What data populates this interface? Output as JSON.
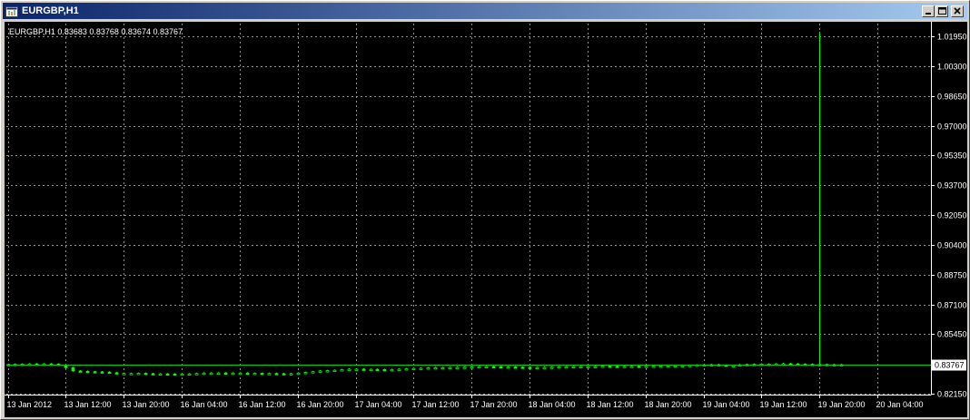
{
  "window": {
    "title": "EURGBP,H1"
  },
  "icons": {
    "app": "chart-app-icon",
    "minimize": "minimize-icon",
    "maximize": "maximize-icon",
    "close": "close-icon"
  },
  "colors": {
    "background": "#000000",
    "grid": "#c0c0c0",
    "bars": "#00ff00",
    "axis": "#ffffff",
    "text": "#ffffff",
    "price_line": "#00cc00"
  },
  "chart_data": {
    "type": "candlestick",
    "header": "EURGBP,H1  0.83683 0.83768 0.83674 0.83767",
    "current_price": 0.83767,
    "current_price_label": "0.83767",
    "ylim": [
      0.8211,
      1.0265
    ],
    "ytick_values": [
      1.0195,
      1.003,
      0.9865,
      0.97,
      0.9535,
      0.937,
      0.9205,
      0.904,
      0.8875,
      0.871,
      0.8545,
      0.8215
    ],
    "ytick_labels": [
      "1.01950",
      "1.00300",
      "0.98650",
      "0.97000",
      "0.95350",
      "0.93700",
      "0.92050",
      "0.90400",
      "0.88750",
      "0.87100",
      "0.85450",
      "0.82150"
    ],
    "xtick_labels": [
      "13 Jan 2012",
      "13 Jan 12:00",
      "13 Jan 20:00",
      "16 Jan 04:00",
      "16 Jan 12:00",
      "16 Jan 20:00",
      "17 Jan 04:00",
      "17 Jan 12:00",
      "17 Jan 20:00",
      "18 Jan 04:00",
      "18 Jan 12:00",
      "18 Jan 20:00",
      "19 Jan 04:00",
      "19 Jan 12:00",
      "19 Jan 20:00",
      "20 Jan 04:00"
    ],
    "xtick_hours": [
      0,
      8,
      16,
      24,
      32,
      40,
      48,
      56,
      64,
      72,
      80,
      88,
      96,
      104,
      112,
      120
    ],
    "grid": true,
    "close": [
      0.8378,
      0.8379,
      0.838,
      0.8381,
      0.838,
      0.8381,
      0.838,
      0.8375,
      0.836,
      0.8342,
      0.834,
      0.8338,
      0.8337,
      0.8336,
      0.8332,
      0.8328,
      0.8328,
      0.8328,
      0.8329,
      0.8327,
      0.8326,
      0.8326,
      0.8325,
      0.8324,
      0.8325,
      0.8326,
      0.8328,
      0.833,
      0.833,
      0.8331,
      0.833,
      0.833,
      0.833,
      0.8329,
      0.8329,
      0.8328,
      0.8328,
      0.8327,
      0.8326,
      0.8327,
      0.833,
      0.8334,
      0.8338,
      0.8342,
      0.8344,
      0.8346,
      0.8349,
      0.8352,
      0.8352,
      0.835,
      0.8351,
      0.835,
      0.8349,
      0.835,
      0.8352,
      0.8354,
      0.8356,
      0.8357,
      0.8359,
      0.836,
      0.836,
      0.8361,
      0.8362,
      0.8363,
      0.8364,
      0.8366,
      0.8366,
      0.8365,
      0.8364,
      0.8364,
      0.8363,
      0.8362,
      0.8361,
      0.8361,
      0.8362,
      0.8363,
      0.8365,
      0.8365,
      0.8366,
      0.8366,
      0.8366,
      0.8367,
      0.8369,
      0.8368,
      0.8367,
      0.8368,
      0.8368,
      0.8367,
      0.8368,
      0.8369,
      0.837,
      0.8371,
      0.8371,
      0.8372,
      0.8373,
      0.8375,
      0.8376,
      0.8377,
      0.8374,
      0.8371,
      0.8372,
      0.8376,
      0.8378,
      0.8379,
      0.838,
      0.838,
      0.8381,
      0.8382,
      0.8381,
      0.838,
      0.8379,
      0.8378,
      0.8378,
      0.8377,
      0.8377,
      0.8377
    ],
    "spike": {
      "bar_index": 112,
      "high": 1.022
    }
  }
}
